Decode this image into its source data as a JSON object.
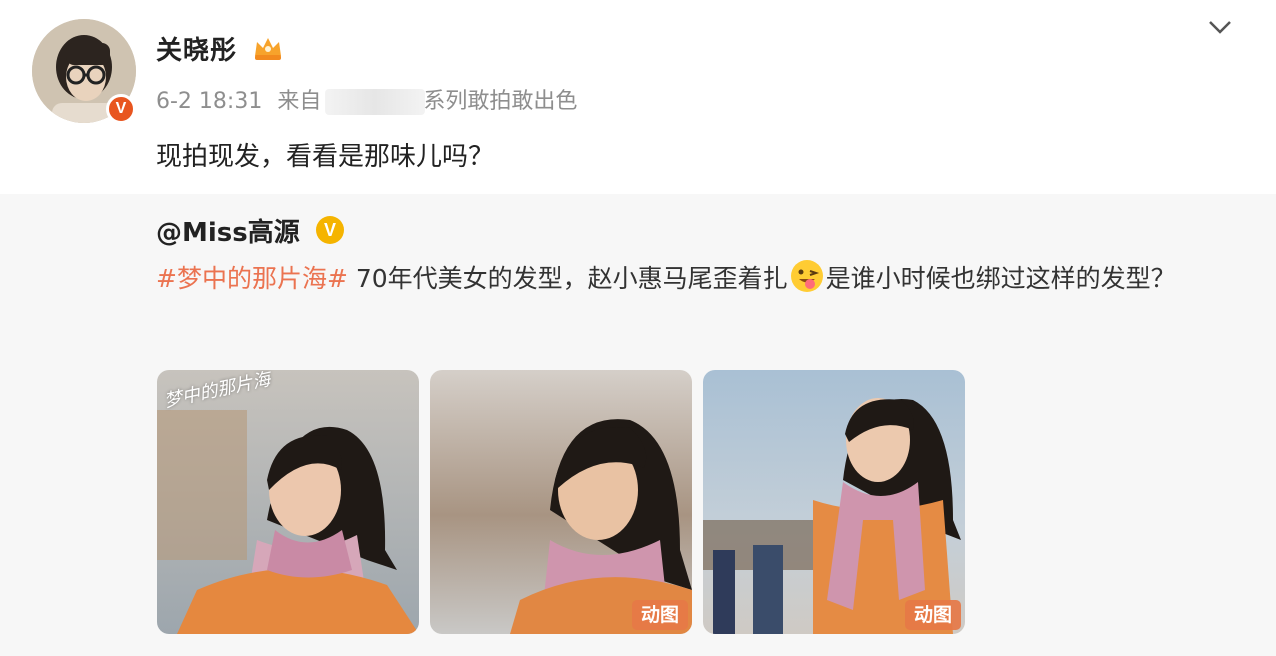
{
  "post": {
    "author": "关晓彤",
    "time": "6-2 18:31",
    "source_prefix": "来自",
    "source_suffix": "系列敢拍敢出色",
    "text": "现拍现发，看看是那味儿吗？",
    "verified_badge": "V"
  },
  "retweet": {
    "author": "@Miss高源",
    "verified_badge": "V",
    "hashtag": "#梦中的那片海#",
    "text_part1": " 70年代美女的发型，赵小惠马尾歪着扎",
    "text_part2": "是谁小时候也绑过这样的发型？",
    "images": [
      {
        "badge": "",
        "caption": "梦中的那片海"
      },
      {
        "badge": "动图"
      },
      {
        "badge": "动图"
      }
    ]
  },
  "icons": {
    "crown": "crown-icon",
    "menu": "chevron-down-icon",
    "emoji": "tongue-out-emoji-icon"
  },
  "colors": {
    "hashtag": "#eb7350",
    "verify_orange": "#e8551f",
    "verify_gold": "#f5b400",
    "meta_gray": "#8e8e8e",
    "retweet_bg": "#f7f7f7"
  }
}
